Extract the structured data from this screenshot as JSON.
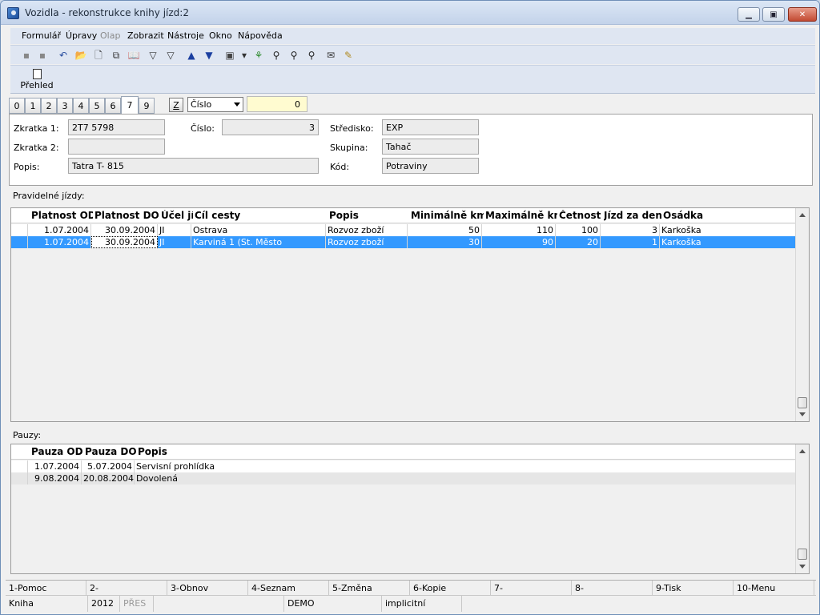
{
  "window": {
    "title": "Vozidla - rekonstrukce knihy jízd:2"
  },
  "menu": [
    {
      "label": "Formulář",
      "enabled": true
    },
    {
      "label": "Úpravy",
      "enabled": true
    },
    {
      "label": "Olap",
      "enabled": false
    },
    {
      "label": "Zobrazit",
      "enabled": true
    },
    {
      "label": "Nástroje",
      "enabled": true
    },
    {
      "label": "Okno",
      "enabled": true
    },
    {
      "label": "Nápověda",
      "enabled": true
    }
  ],
  "toolbar": {
    "icons": [
      "save-icon",
      "save-as-icon",
      "undo-icon",
      "open-folder-icon",
      "new-document-icon",
      "copy-icon",
      "book-icon",
      "filter-icon",
      "filter-edit-icon",
      "arrow-up-icon",
      "arrow-down-icon",
      "camera-icon",
      "dropdown-arrow-icon",
      "tree-icon",
      "binoculars-icon",
      "find-next-icon",
      "find-replace-icon",
      "mail-icon",
      "notes-icon"
    ],
    "glyphs": [
      "▪",
      "▪",
      "↶",
      "📂",
      "🗋",
      "⧉",
      "📖",
      "▽",
      "▽",
      "▲",
      "▼",
      "▣",
      "▾",
      "⚘",
      "⚲",
      "⚲",
      "⚲",
      "✉",
      "✎"
    ],
    "colors": [
      "#888",
      "#888",
      "#2a4fa0",
      "#c9a030",
      "#333",
      "#333",
      "#3a3a3a",
      "#333",
      "#333",
      "#1b3fa0",
      "#1b3fa0",
      "#444",
      "#333",
      "#2c8a2c",
      "#222",
      "#222",
      "#222",
      "#333",
      "#b08a20"
    ]
  },
  "prehled": {
    "label": "Přehled"
  },
  "tabs": [
    "0",
    "1",
    "2",
    "3",
    "4",
    "5",
    "6",
    "7",
    "9"
  ],
  "active_tab": "7",
  "filter": {
    "z_label": "Z",
    "select_value": "Číslo",
    "number_value": "0"
  },
  "form": {
    "zkratka1_label": "Zkratka 1:",
    "zkratka1_value": "2T7 5798",
    "zkratka2_label": "Zkratka 2:",
    "zkratka2_value": "",
    "popis_label": "Popis:",
    "popis_value": "Tatra T- 815",
    "cislo_label": "Číslo:",
    "cislo_value": "3",
    "stredisko_label": "Středisko:",
    "stredisko_value": "EXP",
    "skupina_label": "Skupina:",
    "skupina_value": "Tahač",
    "kod_label": "Kód:",
    "kod_value": "Potraviny"
  },
  "pravidelne": {
    "label": "Pravidelné jízdy:",
    "columns": [
      "Platnost OD",
      "Platnost DO",
      "Účel jízdy",
      "Cíl cesty",
      "Popis",
      "Minimálně km",
      "Maximálně km",
      "Četnost",
      "Jízd za den",
      "Osádka"
    ],
    "rows": [
      [
        "1.07.2004",
        "30.09.2004",
        "JI",
        "Ostrava",
        "Rozvoz zboží",
        "50",
        "110",
        "100",
        "3",
        "Karkoška"
      ],
      [
        "1.07.2004",
        "30.09.2004",
        "JI",
        "Karviná 1 (St. Město",
        "Rozvoz zboží",
        "30",
        "90",
        "20",
        "1",
        "Karkoška"
      ]
    ],
    "selected_row": 1
  },
  "pauzy": {
    "label": "Pauzy:",
    "columns": [
      "Pauza OD",
      "Pauza DO",
      "Popis"
    ],
    "rows": [
      [
        "1.07.2004",
        "5.07.2004",
        "Servisní prohlídka"
      ],
      [
        "9.08.2004",
        "20.08.2004",
        "Dovolená"
      ]
    ]
  },
  "fkeys": [
    "1-Pomoc",
    "2-",
    "3-Obnov",
    "4-Seznam",
    "5-Změna",
    "6-Kopie",
    "7-",
    "8-",
    "9-Tisk",
    "10-Menu"
  ],
  "status": {
    "kniha": "Kniha",
    "year": "2012",
    "pres": "PŘES",
    "demo": "DEMO",
    "implicit": "implicitní"
  }
}
